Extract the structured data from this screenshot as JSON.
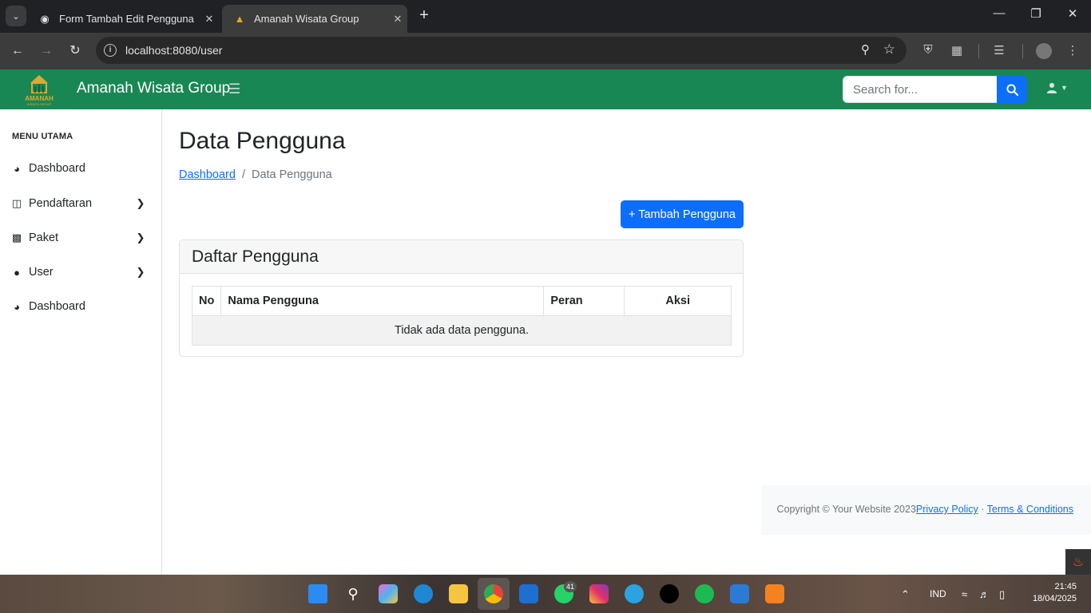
{
  "browser": {
    "tabs": [
      {
        "title": "Form Tambah Edit Pengguna",
        "active": false
      },
      {
        "title": "Amanah Wisata Group",
        "active": true
      }
    ],
    "url": "localhost:8080/user"
  },
  "navbar": {
    "brand": "Amanah Wisata Group",
    "logo_text": "AMANAH",
    "logo_subtext": "WISATA GROUP",
    "search_placeholder": "Search for...",
    "accent_color": "#198754"
  },
  "sidebar": {
    "heading": "MENU UTAMA",
    "items": [
      {
        "label": "Dashboard",
        "icon": "tachometer-icon",
        "has_submenu": false
      },
      {
        "label": "Pendaftaran",
        "icon": "table-columns-icon",
        "has_submenu": true
      },
      {
        "label": "Paket",
        "icon": "book-open-icon",
        "has_submenu": true
      },
      {
        "label": "User",
        "icon": "user-icon",
        "has_submenu": true
      },
      {
        "label": "Dashboard",
        "icon": "tachometer-icon",
        "has_submenu": false
      }
    ]
  },
  "main": {
    "title": "Data Pengguna",
    "breadcrumb": {
      "link": "Dashboard",
      "separator": "/",
      "current": "Data Pengguna"
    },
    "add_button": "+ Tambah Pengguna",
    "card_title": "Daftar Pengguna",
    "table": {
      "headers": [
        "No",
        "Nama Pengguna",
        "Peran",
        "Aksi"
      ],
      "empty_message": "Tidak ada data pengguna."
    }
  },
  "footer": {
    "copyright": "Copyright © Your Website 2023",
    "privacy": "Privacy Policy",
    "dot": "·",
    "terms": "Terms & Conditions"
  },
  "taskbar": {
    "whatsapp_badge": "41",
    "language": "IND",
    "time": "21:45",
    "date": "18/04/2025"
  }
}
